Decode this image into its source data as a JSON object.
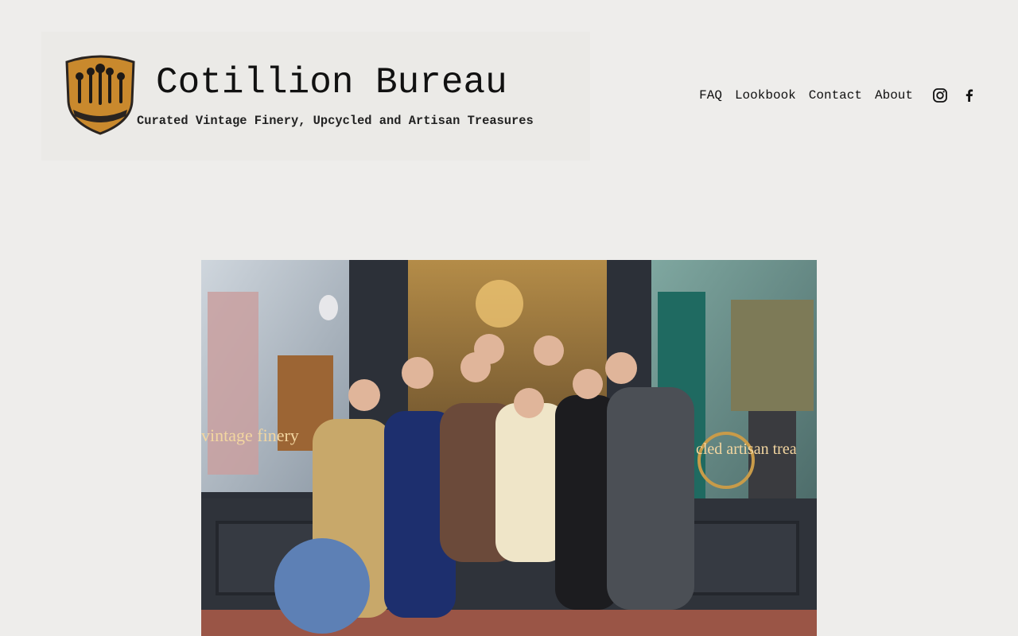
{
  "brand": {
    "title": "Cotillion Bureau",
    "tagline": "Curated Vintage Finery, Upcycled and Artisan Treasures",
    "crest_color": "#c9892d"
  },
  "nav": {
    "items": [
      {
        "label": "FAQ"
      },
      {
        "label": "Lookbook"
      },
      {
        "label": "Contact"
      },
      {
        "label": "About"
      }
    ]
  },
  "social": {
    "icons": [
      "instagram-icon",
      "facebook-icon"
    ]
  },
  "hero": {
    "left_window_text": "vintage finery",
    "right_window_text": "cled artisan trea"
  }
}
